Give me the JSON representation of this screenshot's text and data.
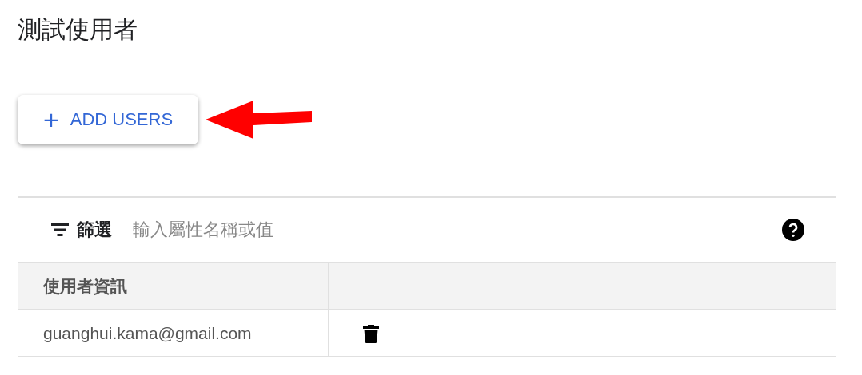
{
  "title": "測試使用者",
  "add_button": {
    "icon": "+",
    "label": "ADD USERS"
  },
  "filter": {
    "label": "篩選",
    "placeholder": "輸入屬性名稱或值"
  },
  "table": {
    "columns": [
      "使用者資訊",
      ""
    ],
    "rows": [
      {
        "email": "guanghui.kama@gmail.com"
      }
    ]
  }
}
